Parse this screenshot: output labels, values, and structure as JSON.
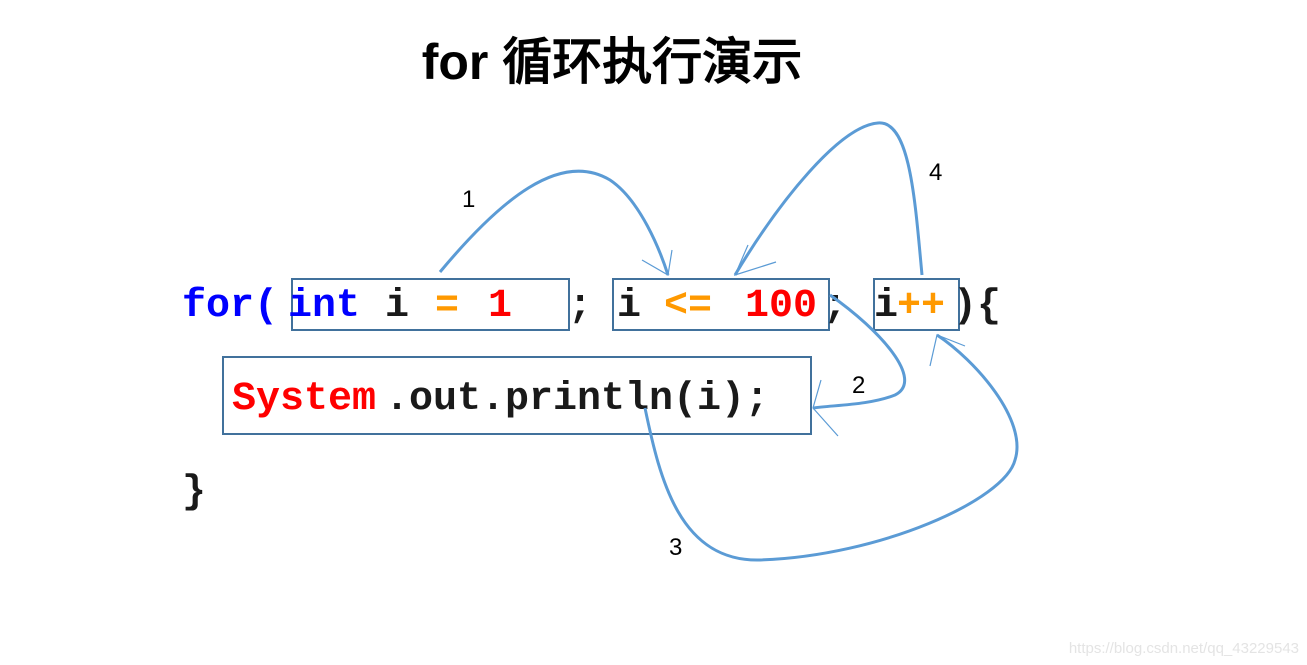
{
  "title": "for 循环执行演示",
  "code": {
    "line1": [
      {
        "text": "for(",
        "color": "#0000ff"
      },
      {
        "text": "int",
        "color": "#0000ff"
      },
      {
        "text": "i",
        "color": "#1a1a1a"
      },
      {
        "text": "=",
        "color": "#ff9900"
      },
      {
        "text": "1",
        "color": "#ff0000"
      },
      {
        "text": ";",
        "color": "#1a1a1a"
      },
      {
        "text": "i",
        "color": "#1a1a1a"
      },
      {
        "text": "<=",
        "color": "#ff9900"
      },
      {
        "text": "100",
        "color": "#ff0000"
      },
      {
        "text": ";",
        "color": "#1a1a1a"
      },
      {
        "text": "i",
        "color": "#1a1a1a"
      },
      {
        "text": "++",
        "color": "#ff9900"
      },
      {
        "text": "){",
        "color": "#1a1a1a"
      }
    ],
    "line2": [
      {
        "text": "System",
        "color": "#ff0000"
      },
      {
        "text": ".out.println(i);",
        "color": "#1a1a1a"
      }
    ],
    "line3": [
      {
        "text": "}",
        "color": "#1a1a1a"
      }
    ]
  },
  "steps": [
    "1",
    "2",
    "3",
    "4"
  ],
  "arrow_color": "#5b9bd5",
  "box_color": "#41719c",
  "watermark": "https://blog.csdn.net/qq_43229543"
}
